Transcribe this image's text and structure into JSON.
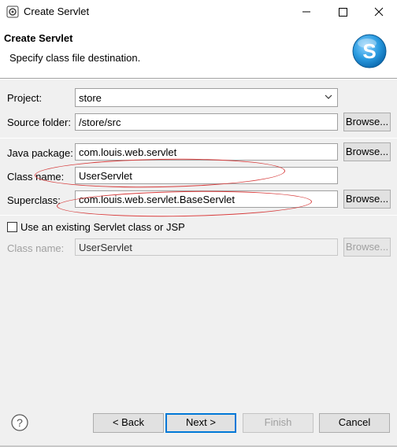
{
  "window": {
    "title": "Create Servlet",
    "icons": {
      "app": "gear-servlet-icon",
      "minimize": "minimize-icon",
      "maximize": "maximize-icon",
      "close": "close-icon"
    }
  },
  "banner": {
    "title": "Create Servlet",
    "subtitle": "Specify class file destination.",
    "logo_letter": "S"
  },
  "form": {
    "project_label": "Project:",
    "project_value": "store",
    "source_folder_label": "Source folder:",
    "source_folder_value": "/store/src",
    "java_package_label": "Java package:",
    "java_package_value": "com.louis.web.servlet",
    "class_name_label": "Class name:",
    "class_name_value": "UserServlet",
    "superclass_label": "Superclass:",
    "superclass_value": "com.louis.web.servlet.BaseServlet",
    "browse_label": "Browse...",
    "existing_checkbox_label": "Use an existing Servlet class or JSP",
    "existing_checked": false,
    "existing_class_name_label": "Class name:",
    "existing_class_name_value": "UserServlet"
  },
  "footer": {
    "back_label": "< Back",
    "next_label": "Next >",
    "finish_label": "Finish",
    "cancel_label": "Cancel",
    "help_icon": "help-icon"
  },
  "colors": {
    "annotation": "#d63a3a",
    "focus": "#0078d7",
    "dialog_bg": "#f0f0f0"
  }
}
